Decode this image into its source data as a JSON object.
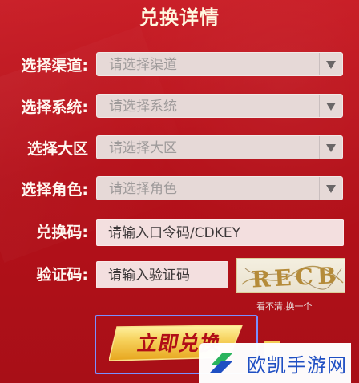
{
  "page": {
    "title": "兑换详情"
  },
  "form": {
    "channel": {
      "label": "选择渠道:",
      "placeholder": "请选择渠道"
    },
    "system": {
      "label": "选择系统:",
      "placeholder": "请选择系统"
    },
    "region": {
      "label": "选择大区",
      "placeholder": "请选择大区"
    },
    "role": {
      "label": "选择角色:",
      "placeholder": "请选择角色"
    },
    "code": {
      "label": "兑换码:",
      "value": "请输入口令码/CDKEY"
    },
    "verify": {
      "label": "验证码:",
      "value": "请输入验证码",
      "captcha_text": "RECB",
      "refresh_label": "看不清,换一个"
    }
  },
  "actions": {
    "redeem_label": "立即兑换"
  },
  "watermark": {
    "text": "欧凯手游网"
  },
  "colors": {
    "background": "#b5131b",
    "title": "#fff7df",
    "label": "#fff7f0",
    "select_bg": "#e6d9d7",
    "input_bg": "#f3dfdf",
    "button": "#f0c43a",
    "focus_border": "#7a8fff",
    "watermark_blue": "#1f4fc3",
    "watermark_green": "#2ab45d"
  },
  "icons": {
    "dropdown": "caret-down-icon",
    "watermark_logo": "okai-logo-icon"
  }
}
